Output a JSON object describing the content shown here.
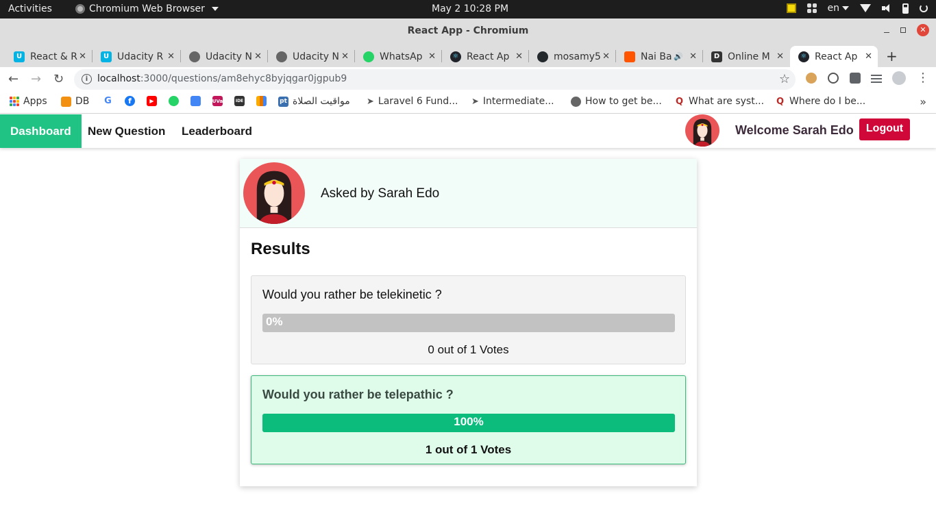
{
  "os_bar": {
    "activities": "Activities",
    "app_name": "Chromium Web Browser",
    "clock": "May 2  10:28 PM",
    "lang": "en"
  },
  "window": {
    "title": "React App - Chromium"
  },
  "tabs": [
    {
      "label": "React & R",
      "icon": "udacity-icon",
      "color": "#02b3e4"
    },
    {
      "label": "Udacity R",
      "icon": "udacity-icon",
      "color": "#02b3e4"
    },
    {
      "label": "Udacity N",
      "icon": "globe-icon",
      "color": "#555555"
    },
    {
      "label": "Udacity N",
      "icon": "globe-icon",
      "color": "#555555"
    },
    {
      "label": "WhatsAp",
      "icon": "whatsapp-icon",
      "color": "#25d366"
    },
    {
      "label": "React Ap",
      "icon": "react-icon",
      "color": "#20232a"
    },
    {
      "label": "mosamy5",
      "icon": "github-icon",
      "color": "#24292e"
    },
    {
      "label": "Nai Ba",
      "icon": "soundcloud-icon",
      "color": "#ff5500"
    },
    {
      "label": "Online M",
      "icon": "d-icon",
      "color": "#333333"
    },
    {
      "label": "React Ap",
      "icon": "react-icon",
      "color": "#20232a"
    }
  ],
  "address_bar": {
    "host": "localhost",
    "path": ":3000/questions/am8ehyc8byjqgar0jgpub9"
  },
  "bookmarks": [
    {
      "label": "Apps"
    },
    {
      "label": "DB"
    },
    {
      "label": ""
    },
    {
      "label": ""
    },
    {
      "label": ""
    },
    {
      "label": ""
    },
    {
      "label": ""
    },
    {
      "label": ""
    },
    {
      "label": ""
    },
    {
      "label": ""
    },
    {
      "label": "مواقيت الصلاة"
    },
    {
      "label": "Laravel 6 Fund..."
    },
    {
      "label": "Intermediate..."
    },
    {
      "label": "How to get be..."
    },
    {
      "label": "What are syst..."
    },
    {
      "label": "Where do I be..."
    }
  ],
  "nav": {
    "links": [
      "Dashboard",
      "New Question",
      "Leaderboard"
    ],
    "welcome": "Welcome Sarah Edo",
    "logout": "Logout"
  },
  "question": {
    "asked_by": "Asked by Sarah Edo",
    "results_title": "Results",
    "options": [
      {
        "text": "Would you rather be telekinetic ?",
        "percent": 0,
        "percent_label": "0%",
        "votes_label": "0 out of 1 Votes"
      },
      {
        "text": "Would you rather be telepathic ?",
        "percent": 100,
        "percent_label": "100%",
        "votes_label": "1 out of 1 Votes"
      }
    ]
  },
  "colors": {
    "accent_green": "#21c384",
    "logout_red": "#d0083a",
    "bar_fill": "#0bbc7d"
  }
}
